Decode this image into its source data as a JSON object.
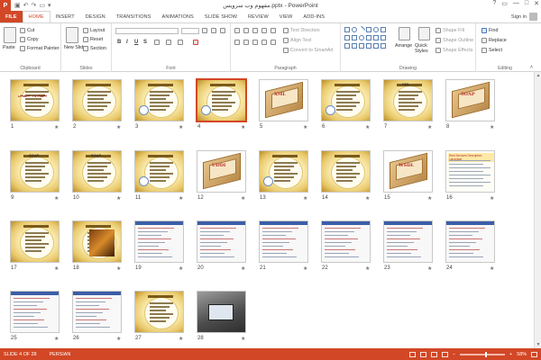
{
  "window": {
    "title": "مفهوم وب سرویس.pptx - PowerPoint",
    "app_icon": "P",
    "controls": [
      "?",
      "▭",
      "—",
      "□",
      "✕"
    ]
  },
  "tabs": [
    {
      "label": "FILE"
    },
    {
      "label": "HOME"
    },
    {
      "label": "INSERT"
    },
    {
      "label": "DESIGN"
    },
    {
      "label": "TRANSITIONS"
    },
    {
      "label": "ANIMATIONS"
    },
    {
      "label": "SLIDE SHOW"
    },
    {
      "label": "REVIEW"
    },
    {
      "label": "VIEW"
    },
    {
      "label": "ADD-INS"
    }
  ],
  "sign_in": "Sign in",
  "ribbon": {
    "clipboard": {
      "name": "Clipboard",
      "paste": "Paste",
      "cut": "Cut",
      "copy": "Copy",
      "format_painter": "Format Painter"
    },
    "slides": {
      "name": "Slides",
      "new_slide": "New Slide",
      "layout": "Layout",
      "reset": "Reset",
      "section": "Section"
    },
    "font": {
      "name": "Font"
    },
    "paragraph": {
      "name": "Paragraph",
      "text_direction": "Text Direction",
      "align_text": "Align Text",
      "convert_smartart": "Convert to SmartArt"
    },
    "drawing": {
      "name": "Drawing",
      "arrange": "Arrange",
      "quick_styles": "Quick Styles",
      "shape_fill": "Shape Fill",
      "shape_outline": "Shape Outline",
      "shape_effects": "Shape Effects"
    },
    "editing": {
      "name": "Editing",
      "find": "Find",
      "replace": "Replace",
      "select": "Select"
    }
  },
  "slides": [
    {
      "n": "1",
      "kind": "gold-title",
      "label": "مفهوم وب سرویس"
    },
    {
      "n": "2",
      "kind": "gold-text"
    },
    {
      "n": "3",
      "kind": "gold-pic"
    },
    {
      "n": "4",
      "kind": "gold-pic",
      "selected": true
    },
    {
      "n": "5",
      "kind": "wood",
      "word": "XML"
    },
    {
      "n": "6",
      "kind": "gold-pic"
    },
    {
      "n": "7",
      "kind": "gold-text",
      "word": "XML"
    },
    {
      "n": "8",
      "kind": "wood",
      "word": "SOAP"
    },
    {
      "n": "9",
      "kind": "gold-text",
      "word": "SOAP"
    },
    {
      "n": "10",
      "kind": "gold-text",
      "word": "SOAP"
    },
    {
      "n": "11",
      "kind": "gold-pic"
    },
    {
      "n": "12",
      "kind": "wood",
      "word": "UDDI"
    },
    {
      "n": "13",
      "kind": "gold-pic"
    },
    {
      "n": "14",
      "kind": "gold-text"
    },
    {
      "n": "15",
      "kind": "wood",
      "word": "WSDL"
    },
    {
      "n": "16",
      "kind": "white-text",
      "word": "Web Services Description Language"
    },
    {
      "n": "17",
      "kind": "gold-text"
    },
    {
      "n": "18",
      "kind": "gold-dark"
    },
    {
      "n": "19",
      "kind": "screenshot"
    },
    {
      "n": "20",
      "kind": "screenshot"
    },
    {
      "n": "21",
      "kind": "screenshot"
    },
    {
      "n": "22",
      "kind": "screenshot"
    },
    {
      "n": "23",
      "kind": "screenshot"
    },
    {
      "n": "24",
      "kind": "screenshot"
    },
    {
      "n": "25",
      "kind": "screenshot"
    },
    {
      "n": "26",
      "kind": "screenshot"
    },
    {
      "n": "27",
      "kind": "gold-text"
    },
    {
      "n": "28",
      "kind": "photo"
    }
  ],
  "status": {
    "slide_info": "SLIDE 4 OF 28",
    "language": "PERSIAN",
    "zoom": "58%",
    "zoom_fraction": 0.58
  },
  "colors": {
    "accent": "#d24726"
  }
}
